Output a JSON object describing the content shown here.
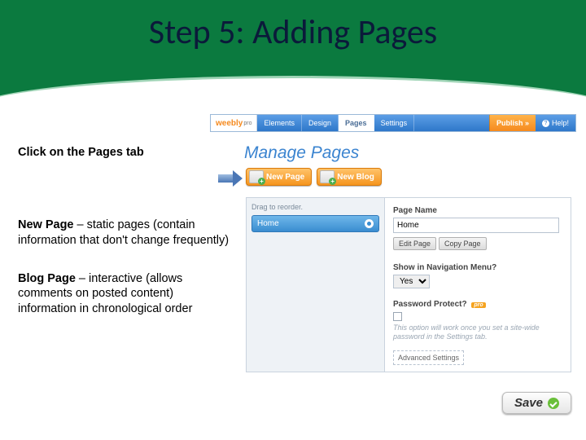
{
  "title": "Step 5: Adding Pages",
  "left": {
    "l1": "Click on the Pages tab",
    "b2_hd": "New Page",
    "b2_txt": " – static pages (contain information that don't change frequently)",
    "b3_hd": "Blog Page",
    "b3_txt1": " – interactive (allows comments on posted content)",
    "b3_txt2": "information in chronological order"
  },
  "toolbar": {
    "logo": "weebly",
    "logo_sub": "pro",
    "tabs": [
      "Elements",
      "Design",
      "Pages",
      "Settings"
    ],
    "active_tab": 2,
    "publish": "Publish »",
    "help": "Help!"
  },
  "manage_title": "Manage Pages",
  "buttons": {
    "new_page": "New Page",
    "new_blog": "New Blog"
  },
  "panel": {
    "drag": "Drag to reorder.",
    "row": "Home",
    "page_name_lbl": "Page Name",
    "page_name_val": "Home",
    "edit": "Edit Page",
    "copy": "Copy Page",
    "nav_lbl": "Show in Navigation Menu?",
    "nav_val": "Yes",
    "pw_lbl": "Password Protect?",
    "pw_pro": "pro",
    "pw_note": "This option will work once you set a site-wide password in the Settings tab.",
    "adv": "Advanced Settings"
  },
  "save": "Save"
}
